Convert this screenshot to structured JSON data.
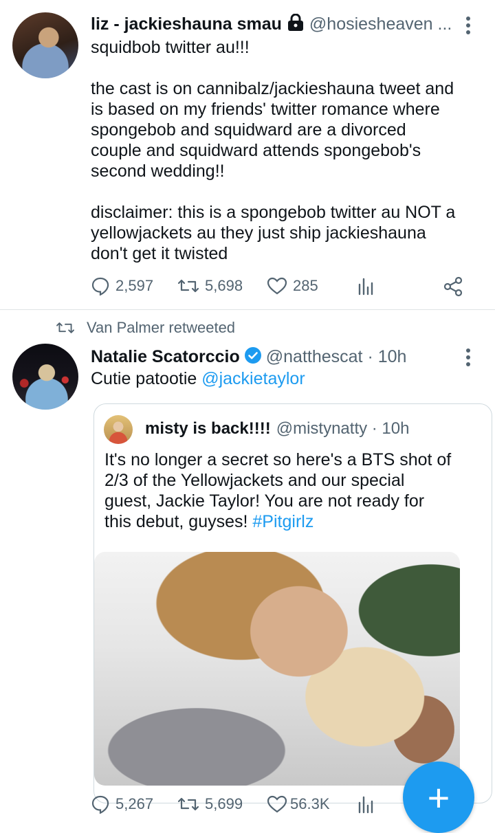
{
  "tweet1": {
    "name": "liz - jackieshauna smau",
    "handle": "@hosiesheaven ...",
    "lines": [
      "squidbob twitter au!!!",
      "",
      "the cast is on cannibalz/jackieshauna tweet and",
      "is based on my friends' twitter romance where",
      "spongebob and squidward are a divorced",
      "couple and squidward attends spongebob's",
      "second wedding!!",
      "",
      "disclaimer: this is a spongebob twitter au NOT a",
      "yellowjackets au they just ship jackieshauna",
      "don't get it twisted"
    ],
    "stats": {
      "replies": "2,597",
      "retweets": "5,698",
      "likes": "285"
    }
  },
  "tweet2": {
    "retweeted_by": "Van Palmer retweeted",
    "name": "Natalie Scatorccio",
    "handle": "@natthescat · 10h",
    "text_prefix": "Cutie patootie ",
    "mention": "@jackietaylor",
    "quote": {
      "name": "misty is back!!!!",
      "handle": "@mistynatty · 10h",
      "lines": [
        "It's no longer a secret so here's a BTS shot of",
        "2/3 of the Yellowjackets and our special",
        "guest, Jackie Taylor! You are not ready for"
      ],
      "last_line_prefix": "this debut, guyses! ",
      "hashtag": "#Pitgirlz"
    },
    "stats": {
      "replies": "5,267",
      "retweets": "5,699",
      "likes": "56.3K"
    }
  },
  "fab": {
    "label": "+"
  },
  "colors": {
    "accent": "#1d9bf0",
    "muted": "#536471",
    "text": "#0f1419"
  }
}
